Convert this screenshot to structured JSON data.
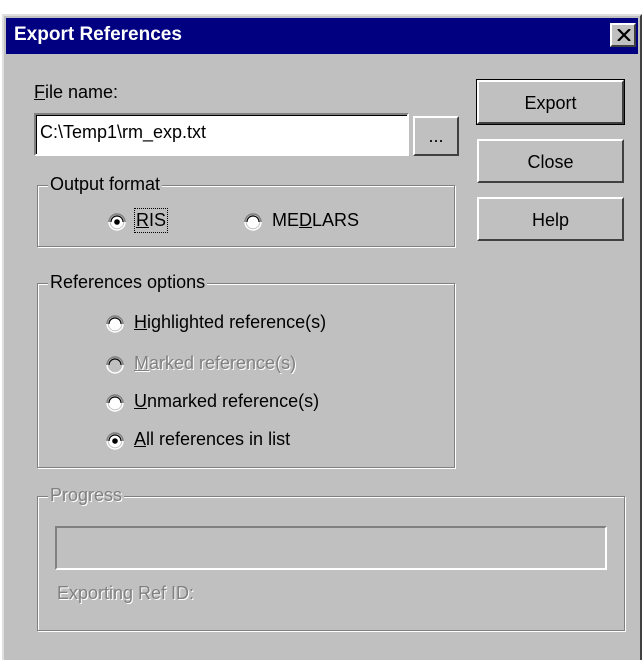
{
  "window": {
    "title": "Export References"
  },
  "file": {
    "label_prefix": "",
    "label_accel": "F",
    "label_rest": "ile name:",
    "value": "C:\\Temp1\\rm_exp.txt",
    "browse_label": "..."
  },
  "buttons": {
    "export": "Export",
    "close": "Close",
    "help": "Help"
  },
  "output_format": {
    "title": "Output format",
    "options": [
      {
        "pre": "",
        "accel": "R",
        "post": "IS",
        "selected": true
      },
      {
        "pre": "ME",
        "accel": "D",
        "post": "LARS",
        "selected": false
      }
    ]
  },
  "references_options": {
    "title": "References options",
    "options": [
      {
        "accel": "H",
        "post": "ighlighted reference(s)",
        "selected": false,
        "enabled": true
      },
      {
        "accel": "M",
        "post": "arked reference(s)",
        "selected": false,
        "enabled": false
      },
      {
        "accel": "U",
        "post": "nmarked reference(s)",
        "selected": false,
        "enabled": true
      },
      {
        "accel": "A",
        "post": "ll references in list",
        "selected": true,
        "enabled": true
      }
    ]
  },
  "progress": {
    "title": "Progress",
    "exporting_label": "Exporting Ref ID:",
    "fraction": 0
  }
}
